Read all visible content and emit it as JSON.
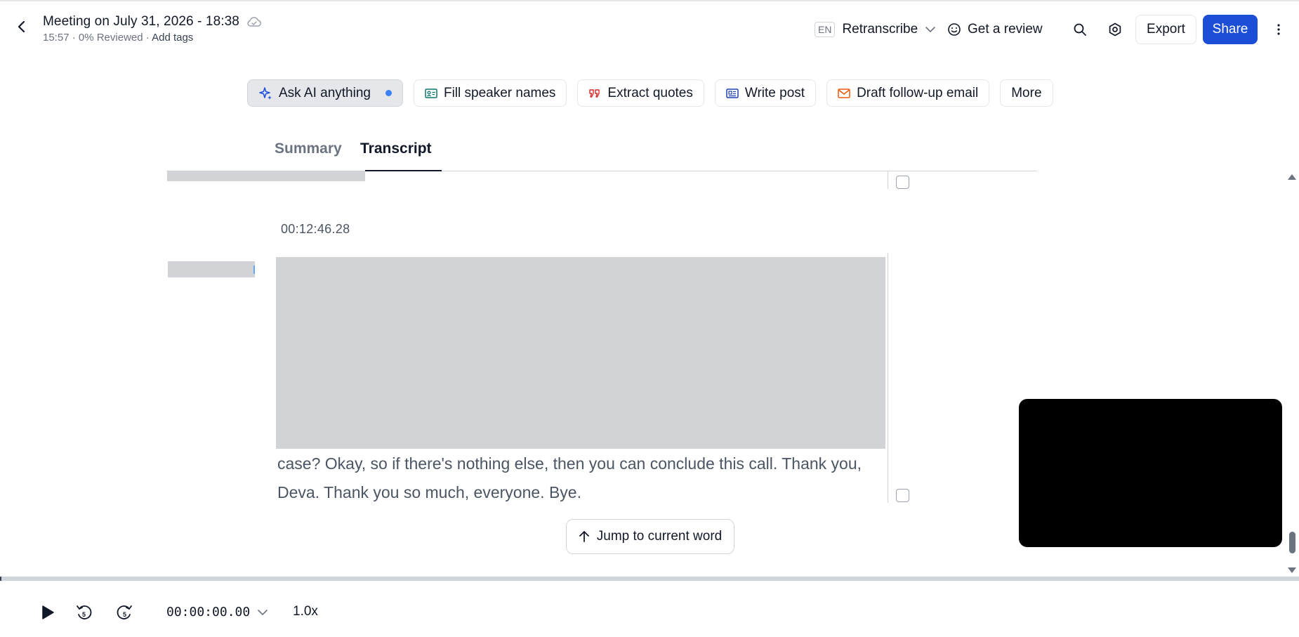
{
  "header": {
    "title": "Meeting on July 31, 2026 - 18:38",
    "meta": "15:57 · 0% Reviewed · ",
    "add_tags": "Add tags",
    "lang": "EN",
    "retranscribe": "Retranscribe",
    "get_review": "Get a review",
    "export": "Export",
    "share": "Share"
  },
  "ai_toolbar": {
    "ask_ai": "Ask AI anything",
    "fill_speakers": "Fill speaker names",
    "extract_quotes": "Extract quotes",
    "write_post": "Write post",
    "draft_email": "Draft follow-up email",
    "more": "More"
  },
  "tabs": {
    "summary": "Summary",
    "transcript": "Transcript"
  },
  "transcript": {
    "timestamp": "00:12:46.28",
    "text": "case? Okay, so if there's nothing else, then you can conclude this call. Thank you, Deva. Thank you so much, everyone. Bye.",
    "jump_button": "Jump to current word"
  },
  "player": {
    "time": "00:00:00.00",
    "speed": "1.0x",
    "progress": 0
  },
  "colors": {
    "accent": "#1d4ed8",
    "dot": "#3b82f6",
    "redaction": "#d1d3d6"
  }
}
